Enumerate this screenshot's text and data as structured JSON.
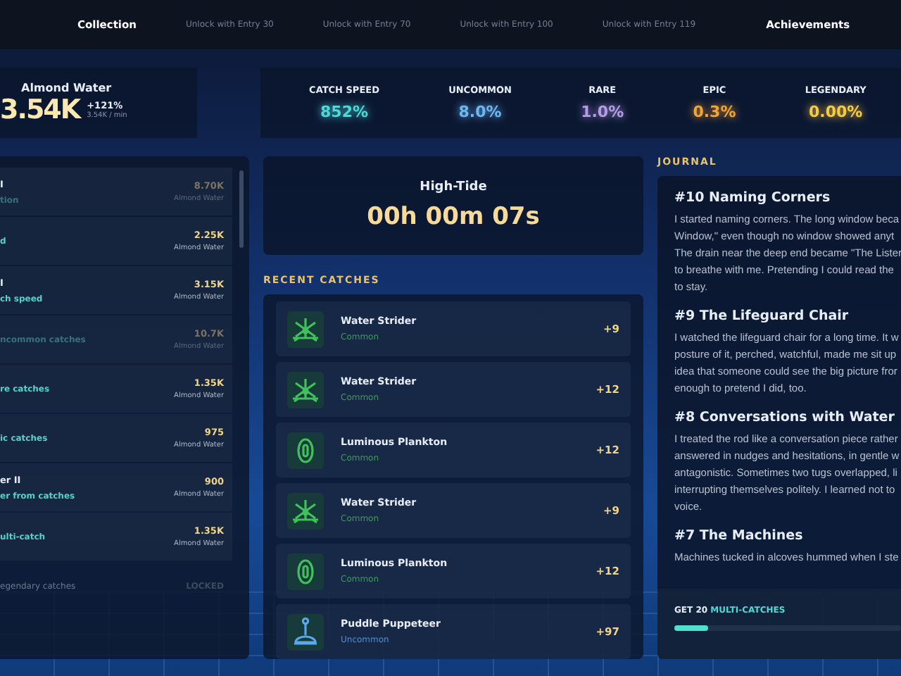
{
  "nav": [
    {
      "label": "Collection",
      "locked": false
    },
    {
      "label": "Unlock with Entry 30",
      "locked": true
    },
    {
      "label": "Unlock with Entry 70",
      "locked": true
    },
    {
      "label": "Unlock with Entry 100",
      "locked": true
    },
    {
      "label": "Unlock with Entry 119",
      "locked": true
    },
    {
      "label": "Achievements",
      "locked": false
    }
  ],
  "currency": {
    "name": "Almond Water",
    "amount": "3.54K",
    "change": "+121%",
    "rate": "3.54K / min"
  },
  "stats": [
    {
      "label": "CATCH SPEED",
      "value": "852%",
      "color": "#4fd8d8"
    },
    {
      "label": "UNCOMMON",
      "value": "8.0%",
      "color": "#6cb6f2"
    },
    {
      "label": "RARE",
      "value": "1.0%",
      "color": "#b59de6"
    },
    {
      "label": "EPIC",
      "value": "0.3%",
      "color": "#f2a437"
    },
    {
      "label": "LEGENDARY",
      "value": "0.00%",
      "color": "#f7cb45"
    }
  ],
  "upgrades": [
    {
      "kind": "upgrade",
      "title": "I",
      "desc": "tion",
      "cost": "8.70K",
      "unit": "Almond Water",
      "affordable": false
    },
    {
      "kind": "upgrade",
      "desc": "d",
      "cost": "2.25K",
      "unit": "Almond Water",
      "affordable": true
    },
    {
      "kind": "upgrade",
      "title": "I",
      "desc": "ch speed",
      "cost": "3.15K",
      "unit": "Almond Water",
      "affordable": true
    },
    {
      "kind": "upgrade",
      "desc": "ncommon catches",
      "cost": "10.7K",
      "unit": "Almond Water",
      "affordable": false
    },
    {
      "kind": "upgrade",
      "desc": "re catches",
      "cost": "1.35K",
      "unit": "Almond Water",
      "affordable": true
    },
    {
      "kind": "upgrade",
      "desc": "ic catches",
      "cost": "975",
      "unit": "Almond Water",
      "affordable": true
    },
    {
      "kind": "upgrade",
      "title": "er II",
      "desc": "er from catches",
      "cost": "900",
      "unit": "Almond Water",
      "affordable": true
    },
    {
      "kind": "upgrade",
      "desc": "ulti-catch",
      "cost": "1.35K",
      "unit": "Almond Water",
      "affordable": true
    },
    {
      "kind": "locked",
      "desc": "egendary catches",
      "cost": "LOCKED"
    }
  ],
  "timer": {
    "title": "High-Tide",
    "value": "00h 00m 07s"
  },
  "recent_title": "RECENT CATCHES",
  "catches": [
    {
      "kind": "strider",
      "name": "Water Strider",
      "rarity": "Common",
      "amount": "+9"
    },
    {
      "kind": "strider",
      "name": "Water Strider",
      "rarity": "Common",
      "amount": "+12"
    },
    {
      "kind": "plankton",
      "name": "Luminous Plankton",
      "rarity": "Common",
      "amount": "+12"
    },
    {
      "kind": "strider",
      "name": "Water Strider",
      "rarity": "Common",
      "amount": "+9"
    },
    {
      "kind": "plankton",
      "name": "Luminous Plankton",
      "rarity": "Common",
      "amount": "+12"
    },
    {
      "kind": "puppet",
      "name": "Puddle Puppeteer",
      "rarity": "Uncommon",
      "amount": "+97"
    }
  ],
  "journal_title": "JOURNAL",
  "journal": [
    {
      "title": "#10 Naming Corners",
      "text": "I started naming corners. The long window beca\nWindow,\" even though no window showed anyt\nThe drain near the deep end became \"The Lister\nto breathe with me. Pretending I could read the\nto stay."
    },
    {
      "title": "#9 The Lifeguard Chair",
      "text": "I watched the lifeguard chair for a long time. It w\nposture of it, perched, watchful, made me sit up\nidea that someone could see the big picture fror\nenough to pretend I did, too."
    },
    {
      "title": "#8 Conversations with Water",
      "text": "I treated the rod like a conversation piece rather\nanswered in nudges and hesitations, in gentle w\nantagonistic. Sometimes two tugs overlapped, li\ninterrupting themselves politely. I learned not to\nvoice."
    },
    {
      "title": "#7 The Machines",
      "text": "Machines tucked in alcoves hummed when I ste"
    }
  ],
  "goal": {
    "prefix": "GET 20",
    "highlight": "MULTI-CATCHES",
    "level": 0.15
  }
}
